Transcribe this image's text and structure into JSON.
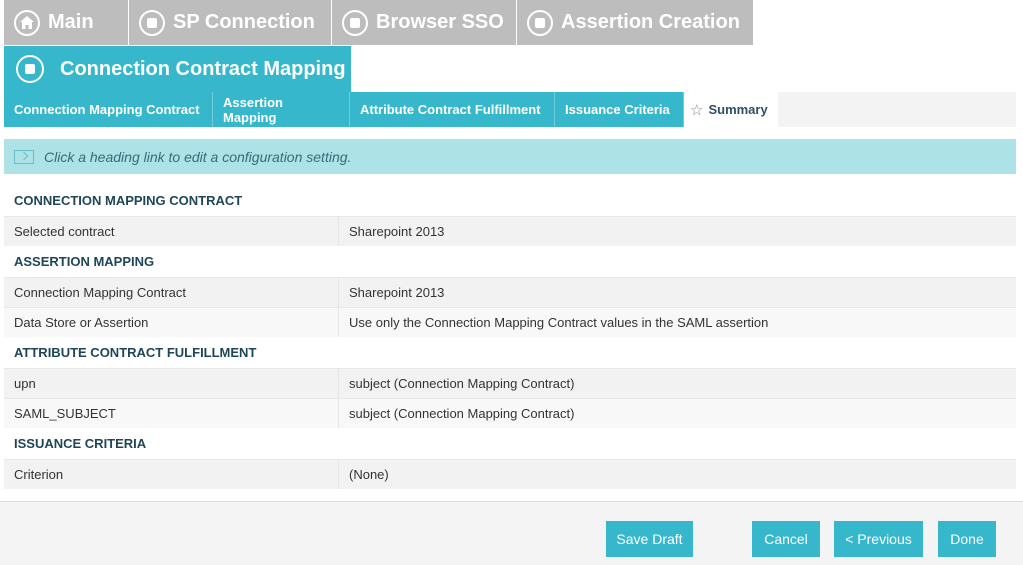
{
  "breadcrumb": [
    {
      "label": "Main",
      "icon": "home-icon"
    },
    {
      "label": "SP Connection",
      "icon": "circle-stop-icon"
    },
    {
      "label": "Browser SSO",
      "icon": "circle-stop-icon"
    },
    {
      "label": "Assertion Creation",
      "icon": "circle-stop-icon"
    }
  ],
  "section": {
    "title": "Connection Contract Mapping",
    "icon": "circle-stop-icon"
  },
  "tabs": [
    {
      "label": "Connection Mapping Contract"
    },
    {
      "label": "Assertion Mapping"
    },
    {
      "label": "Attribute Contract Fulfillment"
    },
    {
      "label": "Issuance Criteria"
    },
    {
      "label": "Summary",
      "active": true,
      "icon": "star-icon"
    }
  ],
  "info": {
    "text": "Click a heading link to edit a configuration setting."
  },
  "summary": {
    "groups": [
      {
        "title": "CONNECTION MAPPING CONTRACT",
        "rows": [
          {
            "key": "Selected contract",
            "value": "Sharepoint 2013"
          }
        ]
      },
      {
        "title": "ASSERTION MAPPING",
        "rows": [
          {
            "key": "Connection Mapping Contract",
            "value": "Sharepoint 2013"
          },
          {
            "key": "Data Store or Assertion",
            "value": "Use only the Connection Mapping Contract values in the SAML assertion"
          }
        ]
      },
      {
        "title": "ATTRIBUTE CONTRACT FULFILLMENT",
        "rows": [
          {
            "key": "upn",
            "value": "subject (Connection Mapping Contract)"
          },
          {
            "key": "SAML_SUBJECT",
            "value": "subject (Connection Mapping Contract)"
          }
        ]
      },
      {
        "title": "ISSUANCE CRITERIA",
        "rows": [
          {
            "key": "Criterion",
            "value": "(None)"
          }
        ]
      }
    ]
  },
  "buttons": {
    "save_draft": "Save Draft",
    "cancel": "Cancel",
    "previous": "< Previous",
    "done": "Done"
  },
  "colors": {
    "accent": "#36b7cc",
    "inactive_tab": "#bdbdbd",
    "info_bg": "#ade3e6",
    "heading_text": "#1e4658"
  }
}
